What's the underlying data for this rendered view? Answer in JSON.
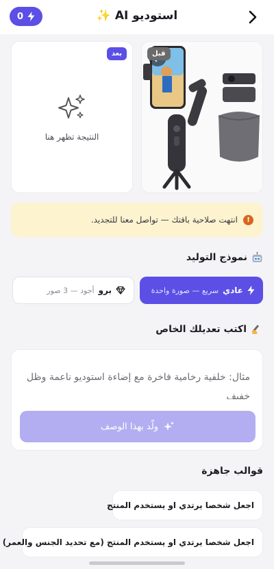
{
  "header": {
    "title": "استوديو AI ✨",
    "credits": "0",
    "back_icon": "chevron-right-icon",
    "credits_icon": "lightning-icon"
  },
  "preview": {
    "before_badge": "قبل",
    "after_badge": "بعد",
    "result_placeholder": "النتيجة تظهر هنا",
    "placeholder_icon": "sparkles-icon",
    "swap_icon": "swap-icon"
  },
  "alert": {
    "text": "انتهت صلاحية باقتك — تواصل معنا للتجديد.",
    "icon": "exclamation-icon"
  },
  "model": {
    "title": "نموذج التوليد",
    "title_icon": "robot-icon",
    "options": [
      {
        "name": "عادي",
        "desc": "سريع — صورة واحدة",
        "icon": "lightning-icon",
        "selected": true
      },
      {
        "name": "برو",
        "desc": "أجود — 3 صور",
        "icon": "diamond-icon",
        "selected": false
      }
    ]
  },
  "edit": {
    "title": "اكتب تعديلك الخاص",
    "title_icon": "writing-hand-icon",
    "placeholder": "مثال: خلفية رخامية فاخرة مع إضاءة استوديو ناعمة وظل خفيف",
    "generate_label": "ولّد بهذا الوصف"
  },
  "templates": {
    "title": "قوالب جاهزة",
    "items": [
      "اجعل شخصا يرتدي او يستخدم المنتج",
      "اجعل شخصا يرتدي او يستخدم المنتج (مع تحديد الجنس والعمر)"
    ]
  },
  "colors": {
    "accent": "#5b4fe6",
    "accent_disabled": "#b3aef1",
    "alert_bg": "#fdf3cf",
    "alert_icon": "#d9651d"
  }
}
